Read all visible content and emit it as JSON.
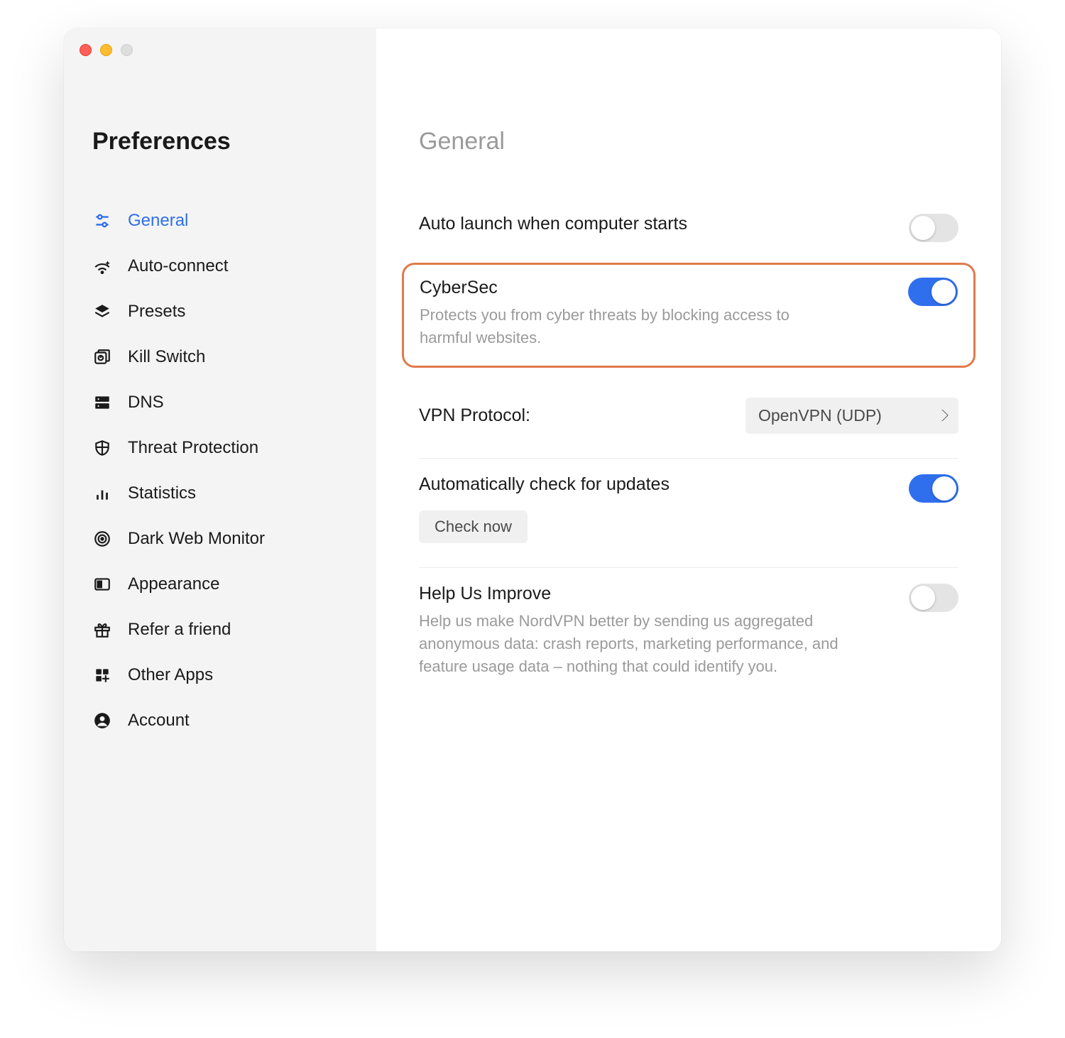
{
  "window_title": "Preferences",
  "sidebar": {
    "title": "Preferences",
    "items": [
      {
        "label": "General",
        "active": true
      },
      {
        "label": "Auto-connect"
      },
      {
        "label": "Presets"
      },
      {
        "label": "Kill Switch"
      },
      {
        "label": "DNS"
      },
      {
        "label": "Threat Protection"
      },
      {
        "label": "Statistics"
      },
      {
        "label": "Dark Web Monitor"
      },
      {
        "label": "Appearance"
      },
      {
        "label": "Refer a friend"
      },
      {
        "label": "Other Apps"
      },
      {
        "label": "Account"
      }
    ]
  },
  "main": {
    "heading": "General",
    "autolaunch": {
      "title": "Auto launch when computer starts",
      "enabled": false
    },
    "cybersec": {
      "title": "CyberSec",
      "desc": "Protects you from cyber threats by blocking access to harmful websites.",
      "enabled": true,
      "highlighted": true
    },
    "protocol": {
      "label": "VPN Protocol:",
      "value": "OpenVPN (UDP)"
    },
    "updates": {
      "title": "Automatically check for updates",
      "check_now_label": "Check now",
      "enabled": true
    },
    "improve": {
      "title": "Help Us Improve",
      "desc": "Help us make NordVPN better by sending us aggregated anonymous data: crash reports, marketing performance, and feature usage data – nothing that could identify you.",
      "enabled": false
    }
  },
  "colors": {
    "accent": "#2f6fed",
    "highlight_border": "#e07a4b"
  }
}
